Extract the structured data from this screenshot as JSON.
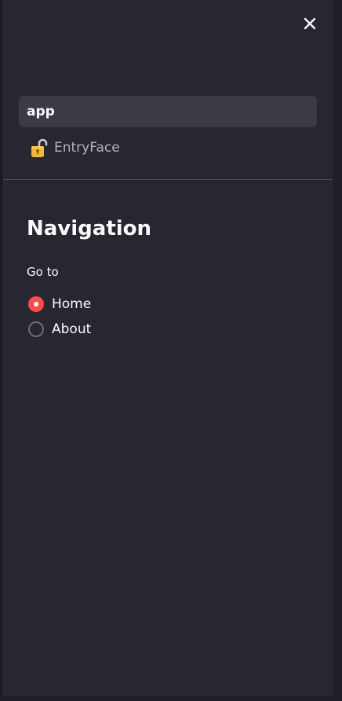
{
  "sidebar": {
    "pages": [
      {
        "label": "app",
        "active": true
      },
      {
        "label": "EntryFace",
        "active": false,
        "icon": "lock-icon"
      }
    ],
    "navigation": {
      "title": "Navigation",
      "radio_label": "Go to",
      "options": [
        {
          "label": "Home",
          "checked": true
        },
        {
          "label": "About",
          "checked": false
        }
      ]
    }
  },
  "colors": {
    "background": "#262730",
    "accent": "#ff4b4b",
    "active_item": "#3a3b45",
    "text": "#fafafa"
  }
}
